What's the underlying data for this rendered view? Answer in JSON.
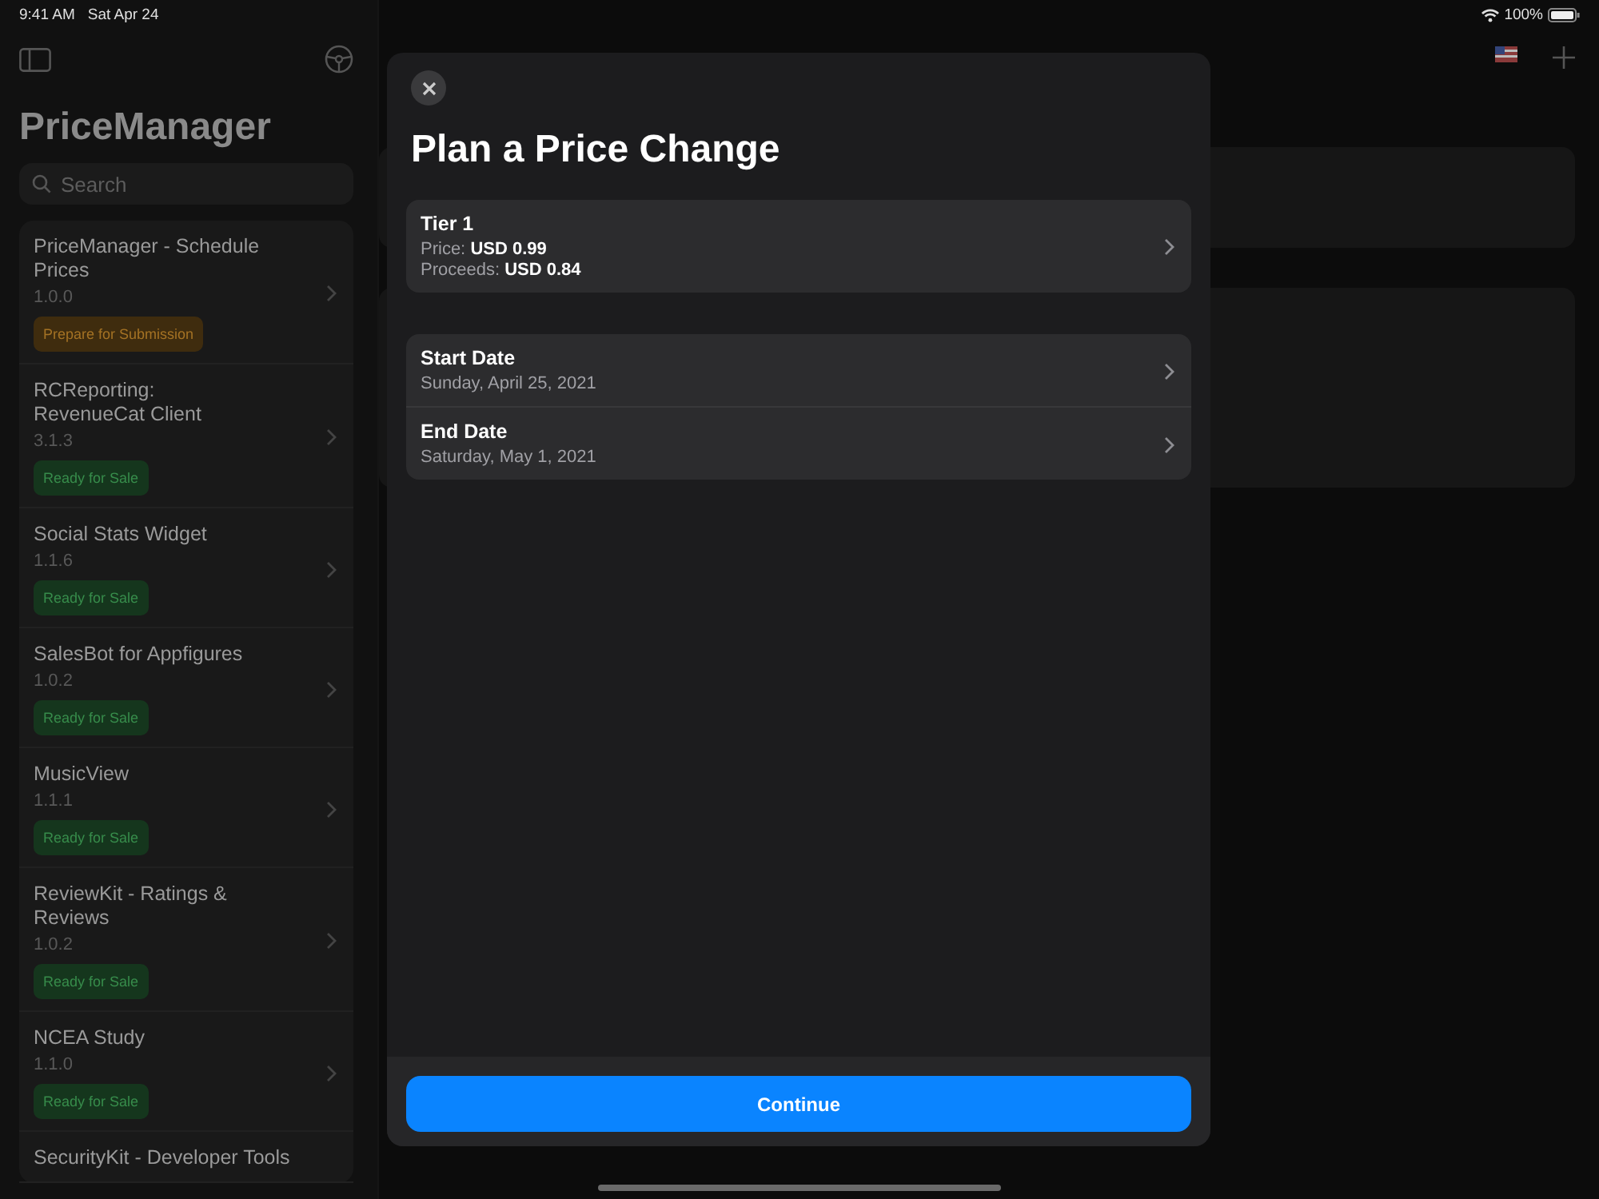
{
  "status_bar": {
    "time": "9:41 AM",
    "date": "Sat Apr 24",
    "battery": "100%"
  },
  "sidebar": {
    "title": "PriceManager",
    "search": {
      "placeholder": "Search"
    },
    "apps": [
      {
        "name": "PriceManager - Schedule Prices",
        "version": "1.0.0",
        "status": "Prepare for Submission",
        "color": "#3f2c0e"
      },
      {
        "name": "RCReporting: RevenueCat Client",
        "version": "3.1.3",
        "status": "Ready for Sale",
        "color": "#15361d"
      },
      {
        "name": "Social Stats Widget",
        "version": "1.1.6",
        "status": "Ready for Sale",
        "color": "#15361d"
      },
      {
        "name": "SalesBot for Appfigures",
        "version": "1.0.2",
        "status": "Ready for Sale",
        "color": "#15361d"
      },
      {
        "name": "MusicView",
        "version": "1.1.1",
        "status": "Ready for Sale",
        "color": "#15361d"
      },
      {
        "name": "ReviewKit - Ratings & Reviews",
        "version": "1.0.2",
        "status": "Ready for Sale",
        "color": "#15361d"
      },
      {
        "name": "NCEA Study",
        "version": "1.1.0",
        "status": "Ready for Sale",
        "color": "#15361d"
      },
      {
        "name": "SecurityKit - Developer Tools"
      }
    ]
  },
  "modal": {
    "title": "Plan a Price Change",
    "tier": {
      "name": "Tier 1",
      "lines": [
        "Price: **USD 0.99**",
        "Proceeds: **USD 0.84**"
      ]
    },
    "dates": [
      {
        "label": "Start Date",
        "value": "Sunday, April 25, 2021"
      },
      {
        "label": "End Date",
        "value": "Saturday, May 1, 2021"
      }
    ],
    "button": "Continue"
  }
}
